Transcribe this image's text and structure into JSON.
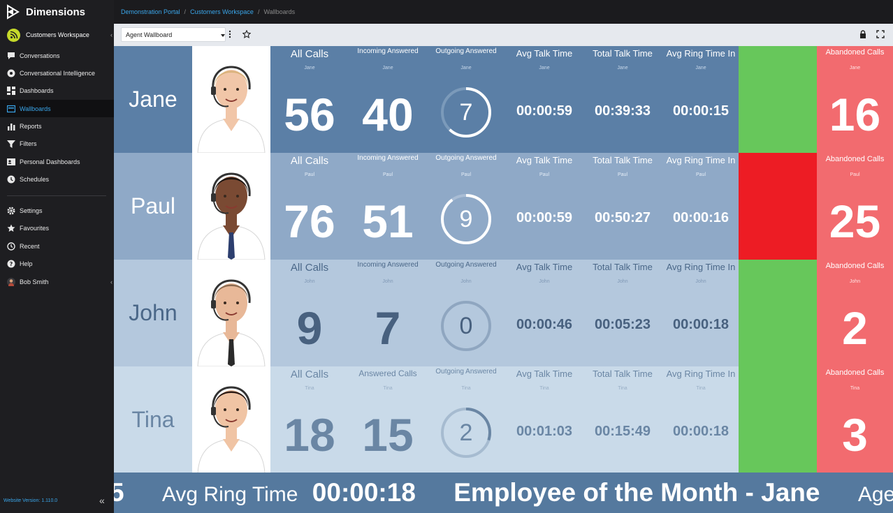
{
  "app": {
    "name": "Dimensions"
  },
  "sidebar": {
    "workspace": "Customers Workspace",
    "items": [
      {
        "label": "Conversations",
        "icon": "chat-icon"
      },
      {
        "label": "Conversational Intelligence",
        "icon": "brain-icon"
      },
      {
        "label": "Dashboards",
        "icon": "dashboard-icon"
      },
      {
        "label": "Wallboards",
        "icon": "wallboard-icon",
        "active": true
      },
      {
        "label": "Reports",
        "icon": "bar-chart-icon"
      },
      {
        "label": "Filters",
        "icon": "filter-icon"
      },
      {
        "label": "Personal Dashboards",
        "icon": "id-card-icon"
      },
      {
        "label": "Schedules",
        "icon": "clock-icon"
      }
    ],
    "items2": [
      {
        "label": "Settings",
        "icon": "gear-icon"
      },
      {
        "label": "Favourites",
        "icon": "star-icon"
      },
      {
        "label": "Recent",
        "icon": "history-icon"
      },
      {
        "label": "Help",
        "icon": "help-icon"
      },
      {
        "label": "Bob Smith",
        "icon": "avatar-icon"
      }
    ],
    "version": "Website Version: 1.110.0"
  },
  "breadcrumb": {
    "items": [
      "Demonstration Portal",
      "Customers Workspace"
    ],
    "current": "Wallboards"
  },
  "toolbar": {
    "selected_wallboard": "Agent Wallboard"
  },
  "colors": {
    "accent": "#3aa6ea",
    "green": "#67c75b",
    "red": "#ed1c24",
    "alert_bg": "#f26b6f"
  },
  "rows": [
    {
      "name": "Jane",
      "sub": "Jane",
      "status_color": "#67c75b",
      "all_calls_label": "All Calls",
      "all_calls": "56",
      "incoming_label": "Incoming Answered",
      "incoming": "40",
      "outgoing_label": "Outgoing Answered",
      "outgoing": "7",
      "avg_talk_label": "Avg Talk Time",
      "avg_talk": "00:00:59",
      "total_talk_label": "Total Talk Time",
      "total_talk": "00:39:33",
      "avg_ring_label": "Avg Ring Time In",
      "avg_ring": "00:00:15",
      "abandoned_label": "Abandoned Calls",
      "abandoned": "16"
    },
    {
      "name": "Paul",
      "sub": "Paul",
      "status_color": "#ed1c24",
      "all_calls_label": "All Calls",
      "all_calls": "76",
      "incoming_label": "Incoming Answered",
      "incoming": "51",
      "outgoing_label": "Outgoing Answered",
      "outgoing": "9",
      "avg_talk_label": "Avg Talk Time",
      "avg_talk": "00:00:59",
      "total_talk_label": "Total Talk Time",
      "total_talk": "00:50:27",
      "avg_ring_label": "Avg Ring Time In",
      "avg_ring": "00:00:16",
      "abandoned_label": "Abandoned Calls",
      "abandoned": "25"
    },
    {
      "name": "John",
      "sub": "John",
      "status_color": "#67c75b",
      "all_calls_label": "All Calls",
      "all_calls": "9",
      "incoming_label": "Incoming Answered",
      "incoming": "7",
      "outgoing_label": "Outgoing Answered",
      "outgoing": "0",
      "avg_talk_label": "Avg Talk Time",
      "avg_talk": "00:00:46",
      "total_talk_label": "Total Talk Time",
      "total_talk": "00:05:23",
      "avg_ring_label": "Avg Ring Time In",
      "avg_ring": "00:00:18",
      "abandoned_label": "Abandoned Calls",
      "abandoned": "2"
    },
    {
      "name": "Tina",
      "sub": "Tina",
      "status_color": "#67c75b",
      "all_calls_label": "All Calls",
      "all_calls": "18",
      "incoming_label": "Answered Calls",
      "incoming": "15",
      "outgoing_label": "Outgoing Answered",
      "outgoing": "2",
      "avg_talk_label": "Avg Talk Time",
      "avg_talk": "00:01:03",
      "total_talk_label": "Total Talk Time",
      "total_talk": "00:15:49",
      "avg_ring_label": "Avg Ring Time In",
      "avg_ring": "00:00:18",
      "abandoned_label": "Abandoned Calls",
      "abandoned": "3"
    }
  ],
  "ticker": {
    "lead": "5",
    "ring_label": "Avg Ring Time",
    "ring_value": "00:00:18",
    "message": "Employee of the Month - Jane",
    "trailing": "Agents Lo"
  }
}
